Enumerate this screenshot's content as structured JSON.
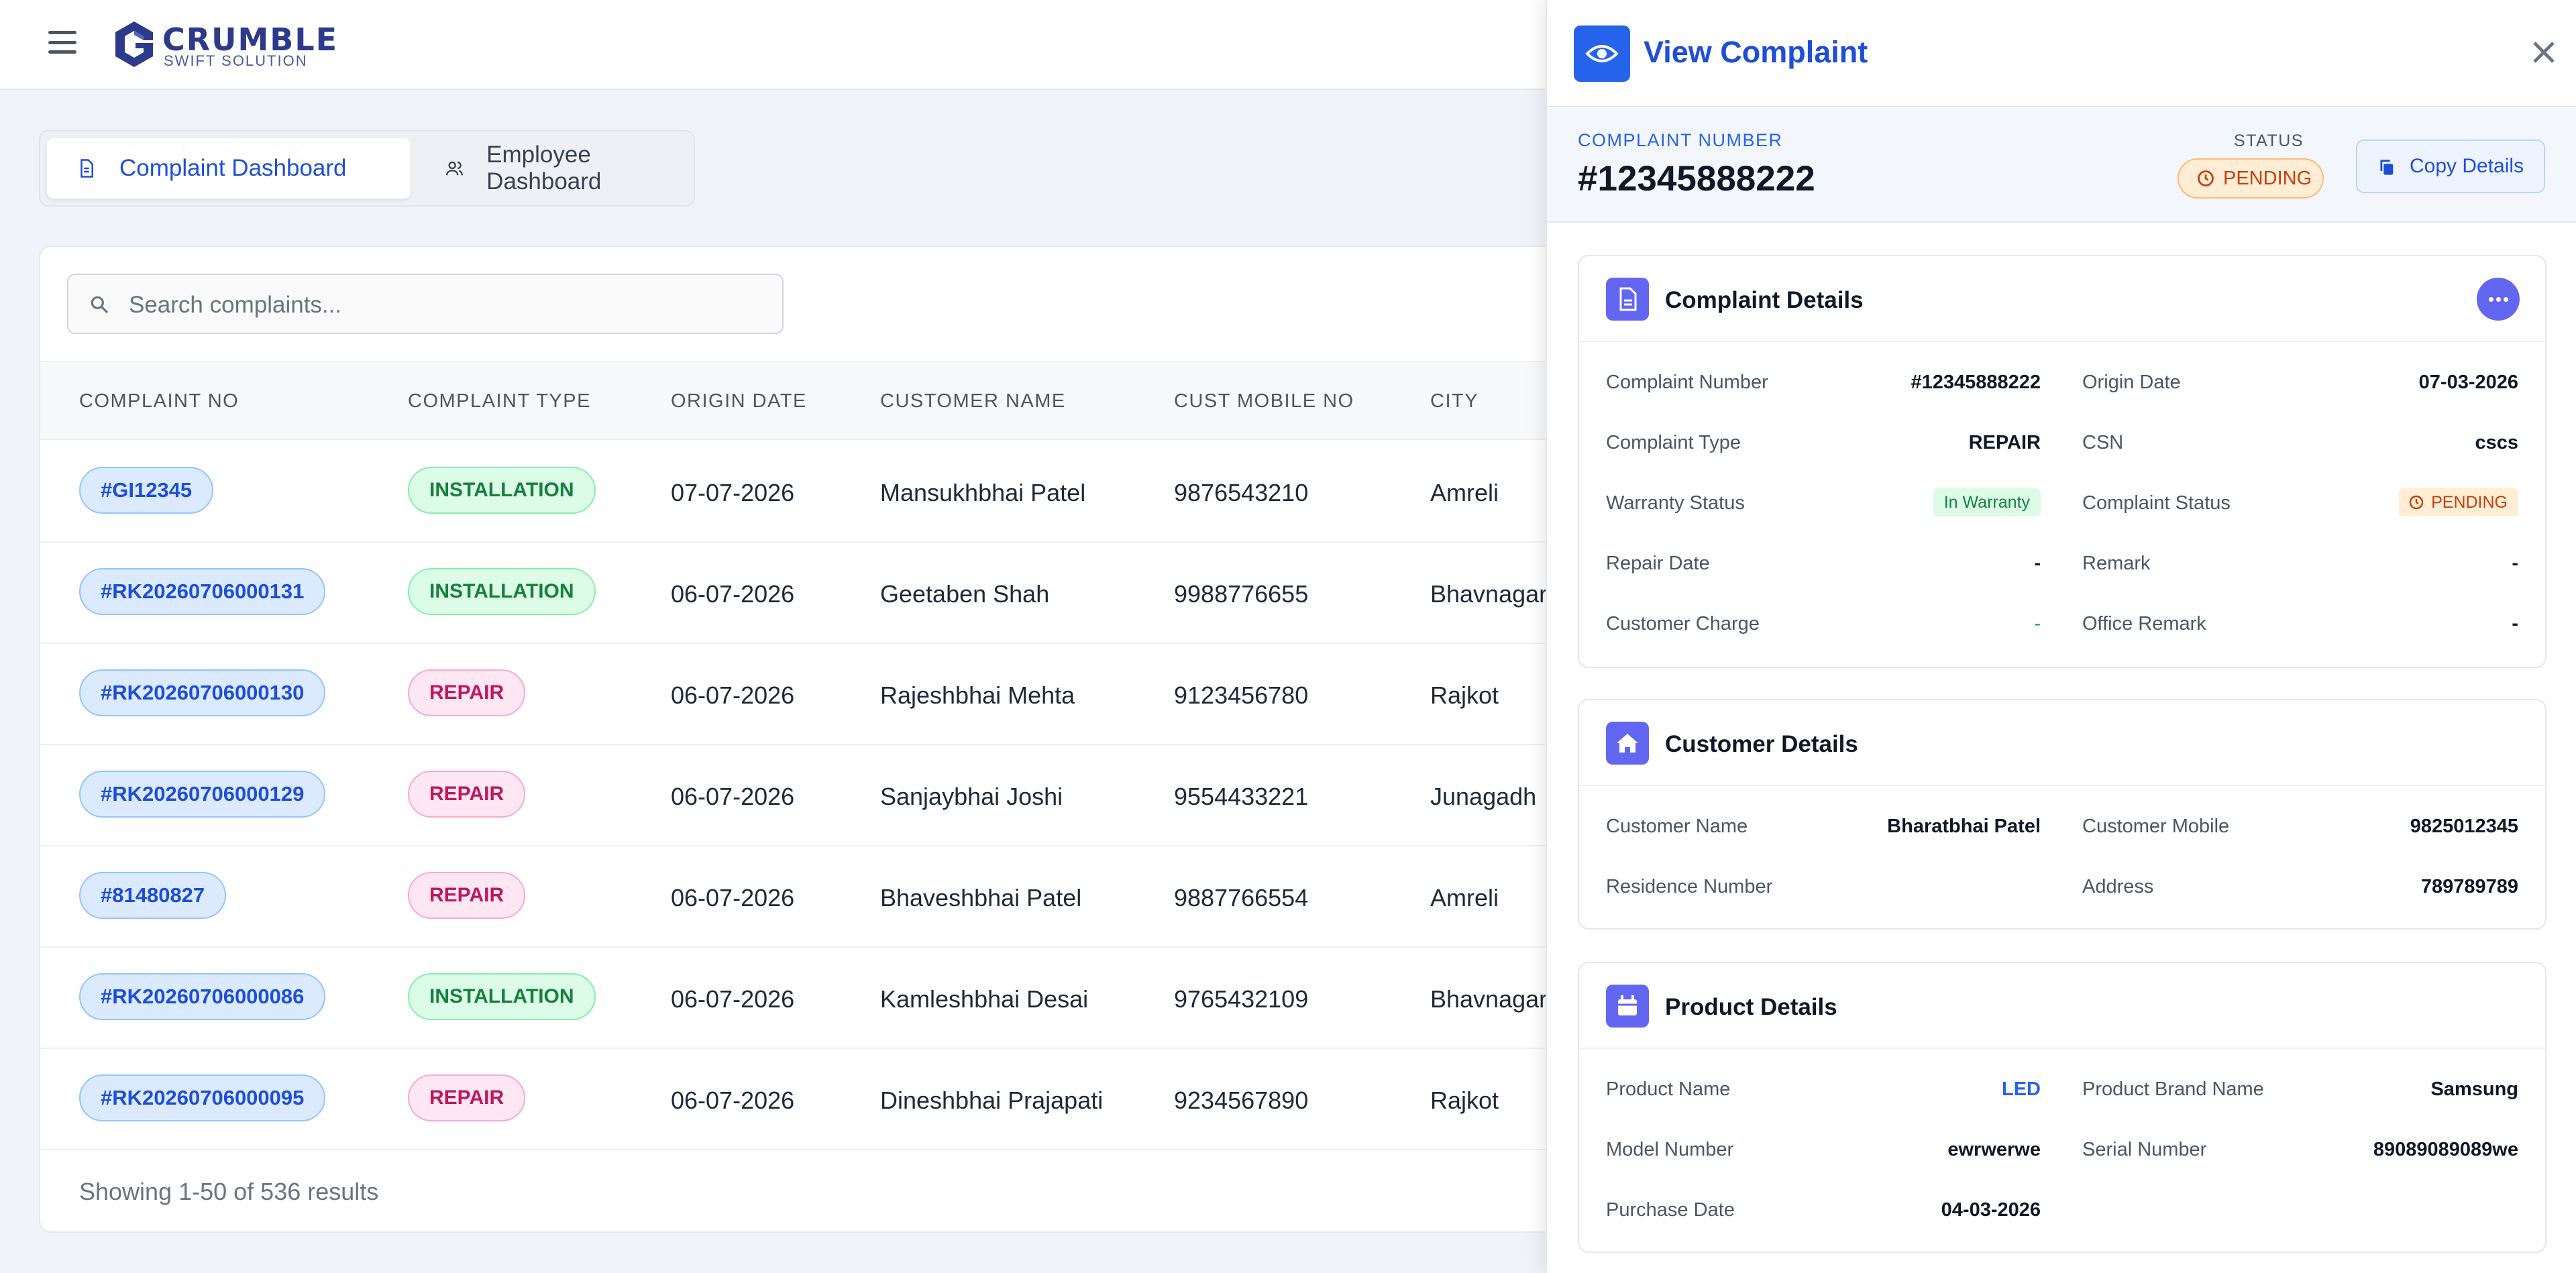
{
  "header": {
    "logo_word": "CRUMBLE",
    "logo_sub": "SWIFT SOLUTION"
  },
  "tabs": [
    {
      "label": "Complaint Dashboard",
      "icon": "document-icon",
      "active": true
    },
    {
      "label": "Employee Dashboard",
      "icon": "users-icon",
      "active": false
    }
  ],
  "search": {
    "placeholder": "Search complaints..."
  },
  "table": {
    "columns": [
      "COMPLAINT NO",
      "COMPLAINT TYPE",
      "ORIGIN DATE",
      "CUSTOMER NAME",
      "CUST MOBILE NO",
      "CITY"
    ],
    "rows": [
      {
        "no": "#GI12345",
        "type": "INSTALLATION",
        "date": "07-07-2026",
        "name": "Mansukhbhai Patel",
        "mobile": "9876543210",
        "city": "Amreli"
      },
      {
        "no": "#RK20260706000131",
        "type": "INSTALLATION",
        "date": "06-07-2026",
        "name": "Geetaben Shah",
        "mobile": "9988776655",
        "city": "Bhavnagar"
      },
      {
        "no": "#RK20260706000130",
        "type": "REPAIR",
        "date": "06-07-2026",
        "name": "Rajeshbhai Mehta",
        "mobile": "9123456780",
        "city": "Rajkot"
      },
      {
        "no": "#RK20260706000129",
        "type": "REPAIR",
        "date": "06-07-2026",
        "name": "Sanjaybhai Joshi",
        "mobile": "9554433221",
        "city": "Junagadh"
      },
      {
        "no": "#81480827",
        "type": "REPAIR",
        "date": "06-07-2026",
        "name": "Bhaveshbhai Patel",
        "mobile": "9887766554",
        "city": "Amreli"
      },
      {
        "no": "#RK20260706000086",
        "type": "INSTALLATION",
        "date": "06-07-2026",
        "name": "Kamleshbhai Desai",
        "mobile": "9765432109",
        "city": "Bhavnagar"
      },
      {
        "no": "#RK20260706000095",
        "type": "REPAIR",
        "date": "06-07-2026",
        "name": "Dineshbhai Prajapati",
        "mobile": "9234567890",
        "city": "Rajkot"
      }
    ],
    "footer": "Showing 1-50 of 536 results"
  },
  "drawer": {
    "title": "View Complaint",
    "summary": {
      "number_label": "COMPLAINT NUMBER",
      "number": "#12345888222",
      "status_label": "STATUS",
      "status": "PENDING",
      "copy_label": "Copy Details"
    },
    "complaint_details": {
      "title": "Complaint Details",
      "complaint_number_label": "Complaint Number",
      "complaint_number": "#12345888222",
      "origin_date_label": "Origin Date",
      "origin_date": "07-03-2026",
      "complaint_type_label": "Complaint Type",
      "complaint_type": "REPAIR",
      "csn_label": "CSN",
      "csn": "cscs",
      "warranty_label": "Warranty Status",
      "warranty": "In Warranty",
      "complaint_status_label": "Complaint Status",
      "complaint_status": "PENDING",
      "repair_date_label": "Repair Date",
      "repair_date": "-",
      "remark_label": "Remark",
      "remark": "-",
      "customer_charge_label": "Customer Charge",
      "customer_charge": "-",
      "office_remark_label": "Office Remark",
      "office_remark": "-"
    },
    "customer_details": {
      "title": "Customer Details",
      "name_label": "Customer Name",
      "name": "Bharatbhai Patel",
      "mobile_label": "Customer Mobile",
      "mobile": "9825012345",
      "residence_label": "Residence Number",
      "address_label": "Address",
      "address": "789789789"
    },
    "product_details": {
      "title": "Product Details",
      "product_name_label": "Product Name",
      "product_name": "LED",
      "brand_label": "Product Brand Name",
      "brand": "Samsung",
      "model_label": "Model Number",
      "model": "ewrwerwe",
      "serial_label": "Serial Number",
      "serial": "89089089089we",
      "purchase_label": "Purchase Date",
      "purchase": "04-03-2026"
    }
  },
  "colors": {
    "accent": "#1d4ed8",
    "section_icon": "#6366f1",
    "pending": "#c2410c",
    "installation": "#15803d",
    "repair": "#be185d"
  }
}
